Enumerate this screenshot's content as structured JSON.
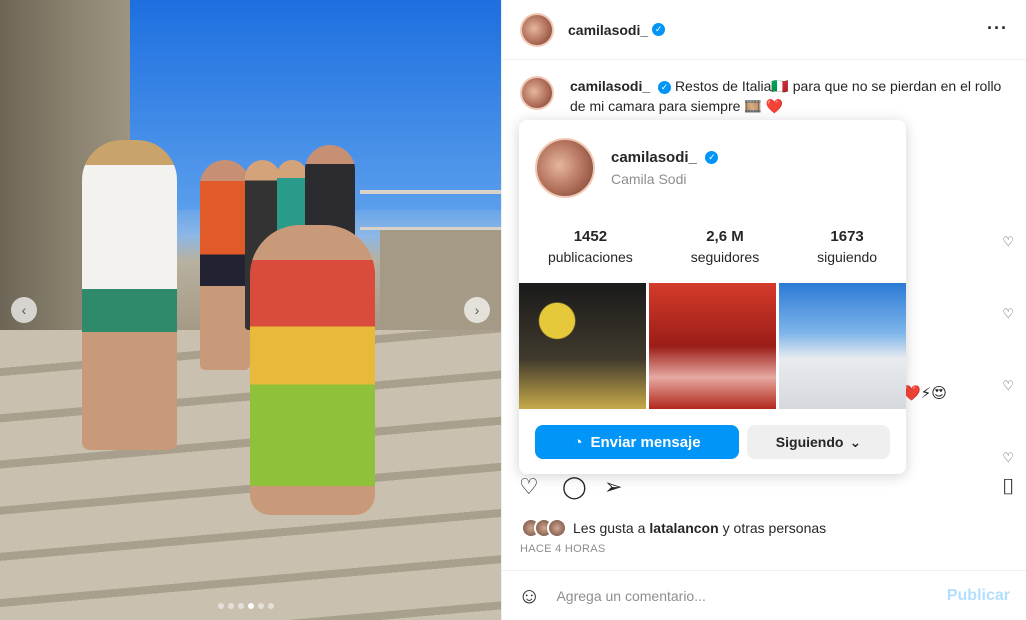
{
  "post": {
    "header_username": "camilasodi_",
    "caption_username": "camilasodi_",
    "caption_text": "Restos de Italia🇮🇹 para que no se pierdan en el rollo de mi camara para siempre 🎞️ ❤️",
    "comment_emoji_tail": "❤️⚡😍",
    "likes_prefix": "Les gusta a ",
    "likes_user": "latalancon",
    "likes_suffix": " y otras personas",
    "time_ago": "HACE 4 HORAS",
    "comment_placeholder": "Agrega un comentario...",
    "publish_label": "Publicar"
  },
  "hover_card": {
    "username": "camilasodi_",
    "full_name": "Camila Sodi",
    "stats": [
      {
        "number": "1452",
        "label": "publicaciones"
      },
      {
        "number": "2,6 M",
        "label": "seguidores"
      },
      {
        "number": "1673",
        "label": "siguiendo"
      }
    ],
    "message_button": "Enviar mensaje",
    "following_button": "Siguiendo"
  },
  "icons": {
    "more": "more-options-icon",
    "verified": "verified-badge-icon",
    "heart": "heart-icon",
    "comment": "comment-icon",
    "share": "share-icon",
    "save": "bookmark-icon",
    "emoji": "emoji-icon",
    "messenger": "messenger-icon",
    "chevron": "chevron-down-icon"
  },
  "colors": {
    "accent": "#0095f6",
    "publish_disabled": "#b2dffc"
  }
}
